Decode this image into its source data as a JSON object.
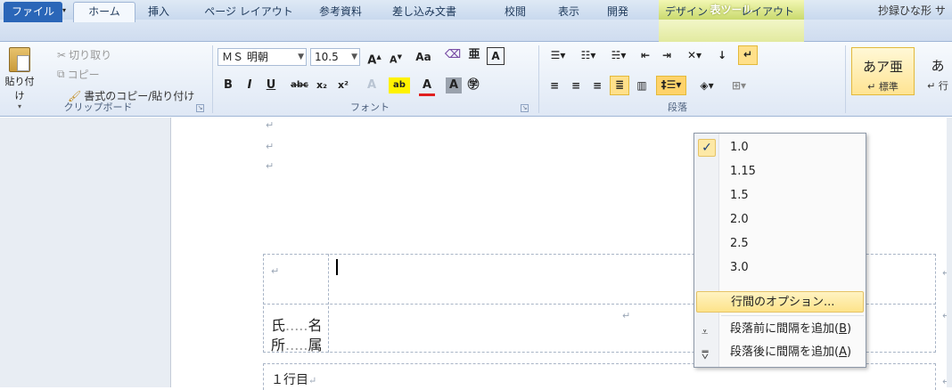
{
  "title_bar": {
    "tools_label": "表ツール",
    "doc_title": "抄録ひな形 サ"
  },
  "tabs": [
    {
      "label": "ファイル"
    },
    {
      "label": "ホーム"
    },
    {
      "label": "挿入"
    },
    {
      "label": "ページ レイアウト"
    },
    {
      "label": "参考資料"
    },
    {
      "label": "差し込み文書"
    },
    {
      "label": "校閲"
    },
    {
      "label": "表示"
    },
    {
      "label": "開発"
    },
    {
      "label": "デザイン"
    },
    {
      "label": "レイアウト"
    }
  ],
  "clipboard": {
    "paste": "貼り付け",
    "cut": "切り取り",
    "copy": "コピー",
    "format_painter": "書式のコピー/貼り付け",
    "group": "クリップボード"
  },
  "font": {
    "name": "ＭＳ 明朝",
    "size": "10.5",
    "group": "フォント",
    "clear_label": "Aa"
  },
  "paragraph": {
    "group": "段落"
  },
  "styles": {
    "sample1": "あア亜",
    "label1": "↵ 標準",
    "sample2": "あ",
    "label2": "↵ 行"
  },
  "document": {
    "row1_left": "↵",
    "row2_left_a": "氏",
    "row2_left_b": "名",
    "row2_left_c": "所",
    "row2_left_d": "属",
    "row3_text": "１行目",
    "return_mark": "↵"
  },
  "line_spacing_menu": {
    "items": [
      "1.0",
      "1.15",
      "1.5",
      "2.0",
      "2.5",
      "3.0"
    ],
    "selected": "1.0",
    "options_label": "行間のオプション...",
    "add_before": "段落前に間隔を追加(",
    "add_before_key": "B",
    "add_after": "段落後に間隔を追加(",
    "add_after_key": "A",
    "close_paren": ")"
  }
}
